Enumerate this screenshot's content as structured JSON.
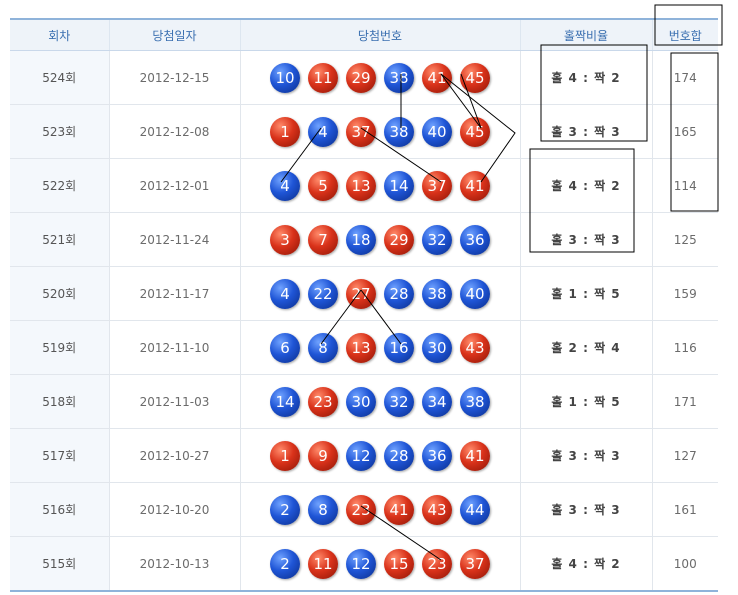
{
  "headers": [
    "회차",
    "당첨일자",
    "당첨번호",
    "홀짝비율",
    "번호합"
  ],
  "colors": {
    "blue": "#1f55d6",
    "red": "#d9321a",
    "header_text": "#3a6fb0"
  },
  "rows": [
    {
      "round": "524회",
      "date": "2012-12-15",
      "balls": [
        {
          "n": "10",
          "c": "blue"
        },
        {
          "n": "11",
          "c": "red"
        },
        {
          "n": "29",
          "c": "red"
        },
        {
          "n": "38",
          "c": "blue"
        },
        {
          "n": "41",
          "c": "red"
        },
        {
          "n": "45",
          "c": "red"
        }
      ],
      "ratio": "홀 4 : 짝 2",
      "sum": "174"
    },
    {
      "round": "523회",
      "date": "2012-12-08",
      "balls": [
        {
          "n": "1",
          "c": "red"
        },
        {
          "n": "4",
          "c": "blue"
        },
        {
          "n": "37",
          "c": "red"
        },
        {
          "n": "38",
          "c": "blue"
        },
        {
          "n": "40",
          "c": "blue"
        },
        {
          "n": "45",
          "c": "red"
        }
      ],
      "ratio": "홀 3 : 짝 3",
      "sum": "165"
    },
    {
      "round": "522회",
      "date": "2012-12-01",
      "balls": [
        {
          "n": "4",
          "c": "blue"
        },
        {
          "n": "5",
          "c": "red"
        },
        {
          "n": "13",
          "c": "red"
        },
        {
          "n": "14",
          "c": "blue"
        },
        {
          "n": "37",
          "c": "red"
        },
        {
          "n": "41",
          "c": "red"
        }
      ],
      "ratio": "홀 4 : 짝 2",
      "sum": "114"
    },
    {
      "round": "521회",
      "date": "2012-11-24",
      "balls": [
        {
          "n": "3",
          "c": "red"
        },
        {
          "n": "7",
          "c": "red"
        },
        {
          "n": "18",
          "c": "blue"
        },
        {
          "n": "29",
          "c": "red"
        },
        {
          "n": "32",
          "c": "blue"
        },
        {
          "n": "36",
          "c": "blue"
        }
      ],
      "ratio": "홀 3 : 짝 3",
      "sum": "125"
    },
    {
      "round": "520회",
      "date": "2012-11-17",
      "balls": [
        {
          "n": "4",
          "c": "blue"
        },
        {
          "n": "22",
          "c": "blue"
        },
        {
          "n": "27",
          "c": "red"
        },
        {
          "n": "28",
          "c": "blue"
        },
        {
          "n": "38",
          "c": "blue"
        },
        {
          "n": "40",
          "c": "blue"
        }
      ],
      "ratio": "홀 1 : 짝 5",
      "sum": "159"
    },
    {
      "round": "519회",
      "date": "2012-11-10",
      "balls": [
        {
          "n": "6",
          "c": "blue"
        },
        {
          "n": "8",
          "c": "blue"
        },
        {
          "n": "13",
          "c": "red"
        },
        {
          "n": "16",
          "c": "blue"
        },
        {
          "n": "30",
          "c": "blue"
        },
        {
          "n": "43",
          "c": "red"
        }
      ],
      "ratio": "홀 2 : 짝 4",
      "sum": "116"
    },
    {
      "round": "518회",
      "date": "2012-11-03",
      "balls": [
        {
          "n": "14",
          "c": "blue"
        },
        {
          "n": "23",
          "c": "red"
        },
        {
          "n": "30",
          "c": "blue"
        },
        {
          "n": "32",
          "c": "blue"
        },
        {
          "n": "34",
          "c": "blue"
        },
        {
          "n": "38",
          "c": "blue"
        }
      ],
      "ratio": "홀 1 : 짝 5",
      "sum": "171"
    },
    {
      "round": "517회",
      "date": "2012-10-27",
      "balls": [
        {
          "n": "1",
          "c": "red"
        },
        {
          "n": "9",
          "c": "red"
        },
        {
          "n": "12",
          "c": "blue"
        },
        {
          "n": "28",
          "c": "blue"
        },
        {
          "n": "36",
          "c": "blue"
        },
        {
          "n": "41",
          "c": "red"
        }
      ],
      "ratio": "홀 3 : 짝 3",
      "sum": "127"
    },
    {
      "round": "516회",
      "date": "2012-10-20",
      "balls": [
        {
          "n": "2",
          "c": "blue"
        },
        {
          "n": "8",
          "c": "blue"
        },
        {
          "n": "23",
          "c": "red"
        },
        {
          "n": "41",
          "c": "red"
        },
        {
          "n": "43",
          "c": "red"
        },
        {
          "n": "44",
          "c": "blue"
        }
      ],
      "ratio": "홀 3 : 짝 3",
      "sum": "161"
    },
    {
      "round": "515회",
      "date": "2012-10-13",
      "balls": [
        {
          "n": "2",
          "c": "blue"
        },
        {
          "n": "11",
          "c": "red"
        },
        {
          "n": "12",
          "c": "blue"
        },
        {
          "n": "15",
          "c": "red"
        },
        {
          "n": "23",
          "c": "red"
        },
        {
          "n": "37",
          "c": "red"
        }
      ],
      "ratio": "홀 4 : 짝 2",
      "sum": "100"
    }
  ]
}
